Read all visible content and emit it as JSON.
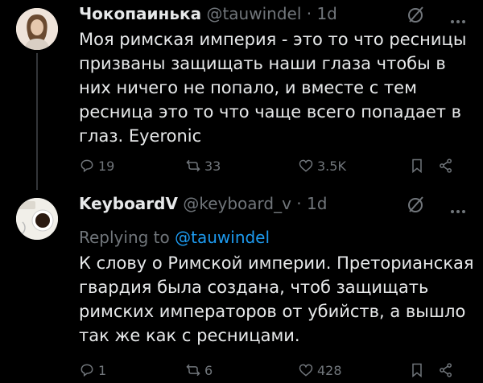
{
  "tweets": [
    {
      "name": "Чокопаинька",
      "handle": "@tauwindel",
      "time": "· 1d",
      "text": "Моя римская империя - это то что ресницы призваны защищать наши глаза чтобы в них ничего не попало, и вместе с тем ресница это то что чаще всего попадает в глаз. Eyeronic",
      "replies": "19",
      "retweets": "33",
      "likes": "3.5K"
    },
    {
      "name": "KeyboardV",
      "handle": "@keyboard_v",
      "time": "· 1d",
      "replying_prefix": "Replying to",
      "replying_handle": "@tauwindel",
      "text": "К слову о Римской империи. Преторианская гвардия была создана, чтоб защищать римских императоров от убийств, а вышло так же как с ресницами.",
      "replies": "1",
      "retweets": "6",
      "likes": "428"
    }
  ],
  "icons": {
    "reply": "reply-icon",
    "retweet": "retweet-icon",
    "like": "heart-icon",
    "bookmark": "bookmark-icon",
    "share": "share-icon",
    "grok": "grok-icon",
    "more": "more-icon"
  },
  "colors": {
    "background": "#000000",
    "text": "#e7e9ea",
    "muted": "#71767b",
    "link": "#1d9bf0"
  }
}
